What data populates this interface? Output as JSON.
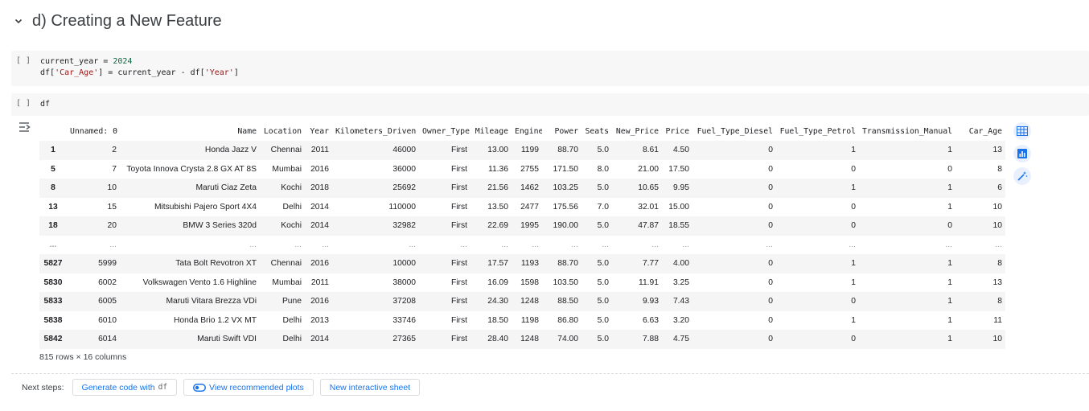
{
  "section": {
    "title": "d) Creating a New Feature"
  },
  "cells": [
    {
      "run_label": "[ ]"
    },
    {
      "run_label": "[ ]",
      "code": "df"
    }
  ],
  "code1": {
    "l1_var": "current_year",
    "l1_op": " = ",
    "l1_num": "2024",
    "l2_a": "df[",
    "l2_str1": "'Car_Age'",
    "l2_b": "] = current_year - df[",
    "l2_str2": "'Year'",
    "l2_c": "]"
  },
  "table": {
    "columns": [
      "",
      "Unnamed: 0",
      "Name",
      "Location",
      "Year",
      "Kilometers_Driven",
      "Owner_Type",
      "Mileage",
      "Engine",
      "Power",
      "Seats",
      "New_Price",
      "Price",
      "Fuel_Type_Diesel",
      "Fuel_Type_Petrol",
      "Transmission_Manual",
      "Car_Age"
    ],
    "rows": [
      [
        "1",
        "2",
        "Honda Jazz V",
        "Chennai",
        "2011",
        "46000",
        "First",
        "13.00",
        "1199",
        "88.70",
        "5.0",
        "8.61",
        "4.50",
        "0",
        "1",
        "1",
        "13"
      ],
      [
        "5",
        "7",
        "Toyota Innova Crysta 2.8 GX AT 8S",
        "Mumbai",
        "2016",
        "36000",
        "First",
        "11.36",
        "2755",
        "171.50",
        "8.0",
        "21.00",
        "17.50",
        "0",
        "0",
        "0",
        "8"
      ],
      [
        "8",
        "10",
        "Maruti Ciaz Zeta",
        "Kochi",
        "2018",
        "25692",
        "First",
        "21.56",
        "1462",
        "103.25",
        "5.0",
        "10.65",
        "9.95",
        "0",
        "1",
        "1",
        "6"
      ],
      [
        "13",
        "15",
        "Mitsubishi Pajero Sport 4X4",
        "Delhi",
        "2014",
        "110000",
        "First",
        "13.50",
        "2477",
        "175.56",
        "7.0",
        "32.01",
        "15.00",
        "0",
        "0",
        "1",
        "10"
      ],
      [
        "18",
        "20",
        "BMW 3 Series 320d",
        "Kochi",
        "2014",
        "32982",
        "First",
        "22.69",
        "1995",
        "190.00",
        "5.0",
        "47.87",
        "18.55",
        "0",
        "0",
        "0",
        "10"
      ],
      [
        "...",
        "...",
        "...",
        "...",
        "...",
        "...",
        "...",
        "...",
        "...",
        "...",
        "...",
        "...",
        "...",
        "...",
        "...",
        "...",
        "..."
      ],
      [
        "5827",
        "5999",
        "Tata Bolt Revotron XT",
        "Chennai",
        "2016",
        "10000",
        "First",
        "17.57",
        "1193",
        "88.70",
        "5.0",
        "7.77",
        "4.00",
        "0",
        "1",
        "1",
        "8"
      ],
      [
        "5830",
        "6002",
        "Volkswagen Vento 1.6 Highline",
        "Mumbai",
        "2011",
        "38000",
        "First",
        "16.09",
        "1598",
        "103.50",
        "5.0",
        "11.91",
        "3.25",
        "0",
        "1",
        "1",
        "13"
      ],
      [
        "5833",
        "6005",
        "Maruti Vitara Brezza VDi",
        "Pune",
        "2016",
        "37208",
        "First",
        "24.30",
        "1248",
        "88.50",
        "5.0",
        "9.93",
        "7.43",
        "0",
        "0",
        "1",
        "8"
      ],
      [
        "5838",
        "6010",
        "Honda Brio 1.2 VX MT",
        "Delhi",
        "2013",
        "33746",
        "First",
        "18.50",
        "1198",
        "86.80",
        "5.0",
        "6.63",
        "3.20",
        "0",
        "1",
        "1",
        "11"
      ],
      [
        "5842",
        "6014",
        "Maruti Swift VDI",
        "Delhi",
        "2014",
        "27365",
        "First",
        "28.40",
        "1248",
        "74.00",
        "5.0",
        "7.88",
        "4.75",
        "0",
        "0",
        "1",
        "10"
      ]
    ],
    "shape": "815 rows × 16 columns"
  },
  "sidebar": {
    "icons": [
      "table-icon",
      "bar-chart-icon",
      "magic-wand-icon"
    ]
  },
  "next_steps": {
    "label": "Next steps:",
    "generate_label": "Generate code with",
    "generate_var": "df",
    "plots_label": "View recommended plots",
    "sheet_label": "New interactive sheet"
  },
  "colors": {
    "accent": "#1a73e8",
    "cell_bg": "#f7f7f7",
    "string": "#a31515",
    "number": "#116644"
  }
}
